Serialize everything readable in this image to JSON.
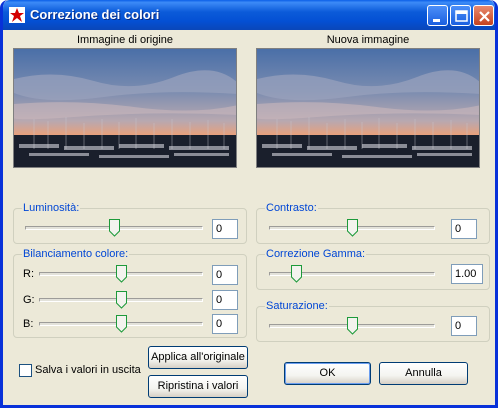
{
  "window": {
    "title": "Correzione dei colori"
  },
  "previews": {
    "original_label": "Immagine di origine",
    "new_label": "Nuova immagine"
  },
  "luminosita": {
    "label": "Luminosità:",
    "value": "0",
    "level": 0.5
  },
  "bilanciamento": {
    "label": "Bilanciamento colore:",
    "r": {
      "label": "R:",
      "value": "0",
      "level": 0.5
    },
    "g": {
      "label": "G:",
      "value": "0",
      "level": 0.5
    },
    "b": {
      "label": "B:",
      "value": "0",
      "level": 0.5
    }
  },
  "contrasto": {
    "label": "Contrasto:",
    "value": "0",
    "level": 0.5
  },
  "gamma": {
    "label": "Correzione Gamma:",
    "value": "1.00",
    "level": 0.16
  },
  "saturazione": {
    "label": "Saturazione:",
    "value": "0",
    "level": 0.5
  },
  "options": {
    "save_label": "Salva i valori in uscita",
    "save_checked": false
  },
  "buttons": {
    "apply": "Applica all'originale",
    "reset": "Ripristina i valori",
    "ok": "OK",
    "cancel": "Annulla"
  },
  "colors": {
    "title_bar": "#0a5fe8",
    "group_label": "#0046d5",
    "dialog_bg": "#ece9d8"
  }
}
